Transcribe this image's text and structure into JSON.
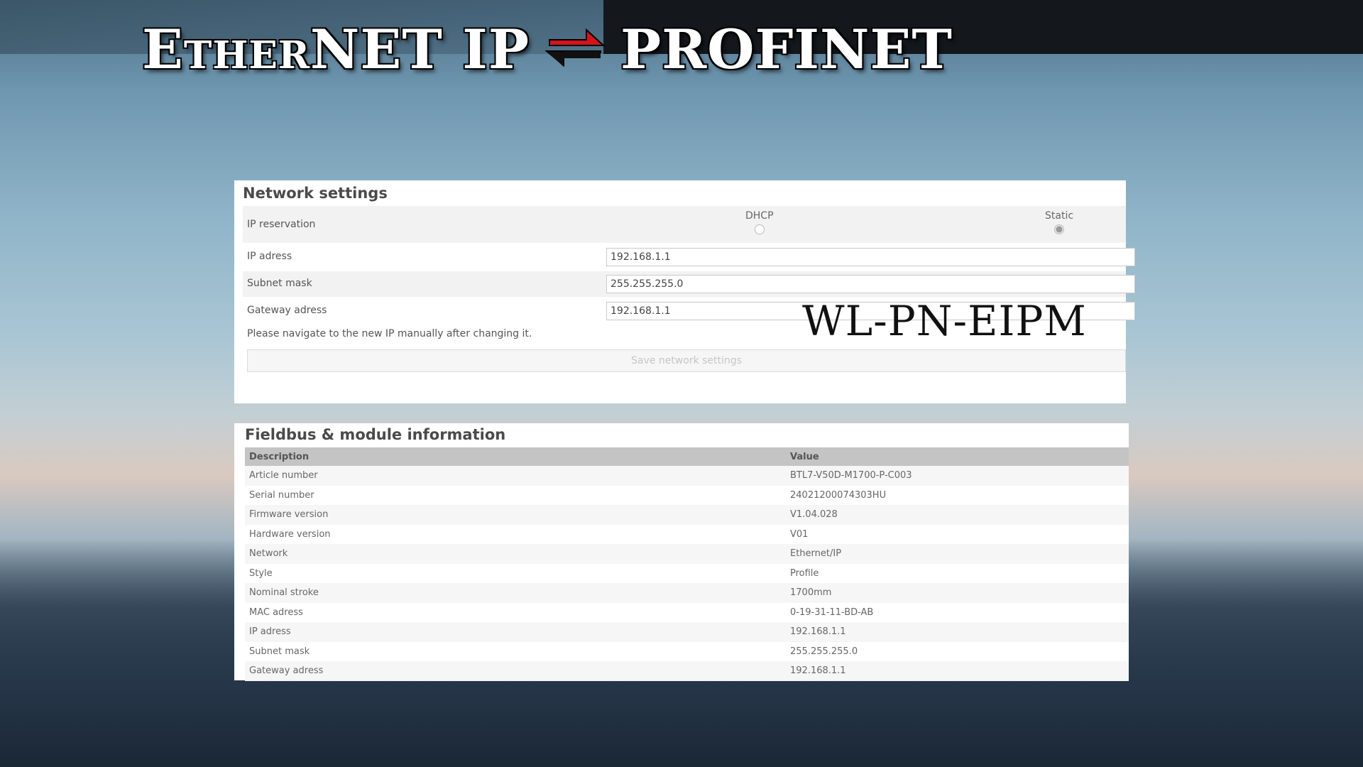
{
  "banner": {
    "title_left": "EtherNET IP",
    "title_right": "PROFINET",
    "arrow_colors": [
      "#d4141c",
      "#111111"
    ]
  },
  "network_settings": {
    "title": "Network settings",
    "ip_reservation_label": "IP reservation",
    "options": [
      {
        "label": "DHCP",
        "selected": false
      },
      {
        "label": "Static",
        "selected": true
      }
    ],
    "fields": [
      {
        "label": "IP adress",
        "value": "192.168.1.1"
      },
      {
        "label": "Subnet mask",
        "value": "255.255.255.0"
      },
      {
        "label": "Gateway adress",
        "value": "192.168.1.1"
      }
    ],
    "note": "Please navigate to the new IP manually after changing it.",
    "save_label": "Save network settings"
  },
  "product_name": "WL-PN-EIPM",
  "fieldbus": {
    "title": "Fieldbus & module information",
    "headers": [
      "Description",
      "Value"
    ],
    "rows": [
      [
        "Article number",
        "BTL7-V50D-M1700-P-C003"
      ],
      [
        "Serial number",
        "24021200074303HU"
      ],
      [
        "Firmware version",
        "V1.04.028"
      ],
      [
        "Hardware version",
        "V01"
      ],
      [
        "Network",
        "Ethernet/IP"
      ],
      [
        "Style",
        "Profile"
      ],
      [
        "Nominal stroke",
        "1700mm"
      ],
      [
        "MAC adress",
        "0-19-31-11-BD-AB"
      ],
      [
        "IP adress",
        "192.168.1.1"
      ],
      [
        "Subnet mask",
        "255.255.255.0"
      ],
      [
        "Gateway adress",
        "192.168.1.1"
      ]
    ]
  }
}
